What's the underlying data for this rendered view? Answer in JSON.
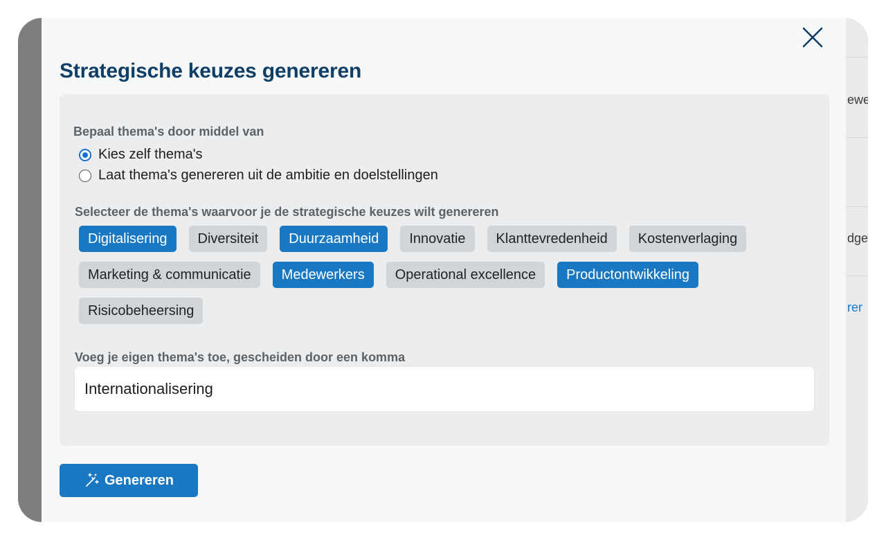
{
  "modal": {
    "title": "Strategische keuzes genereren",
    "close_icon": "close-icon"
  },
  "method": {
    "label": "Bepaal thema's door middel van",
    "options": [
      {
        "label": "Kies zelf thema's",
        "checked": true
      },
      {
        "label": "Laat thema's genereren uit de ambitie en doelstellingen",
        "checked": false
      }
    ]
  },
  "themes": {
    "label": "Selecteer de thema's waarvoor je de strategische keuzes wilt genereren",
    "items": [
      {
        "label": "Digitalisering",
        "selected": true
      },
      {
        "label": "Diversiteit",
        "selected": false
      },
      {
        "label": "Duurzaamheid",
        "selected": true
      },
      {
        "label": "Innovatie",
        "selected": false
      },
      {
        "label": "Klanttevredenheid",
        "selected": false
      },
      {
        "label": "Kostenverlaging",
        "selected": false
      },
      {
        "label": "Marketing & communicatie",
        "selected": false
      },
      {
        "label": "Medewerkers",
        "selected": true
      },
      {
        "label": "Operational excellence",
        "selected": false
      },
      {
        "label": "Productontwikkeling",
        "selected": true
      },
      {
        "label": "Risicobeheersing",
        "selected": false
      }
    ]
  },
  "custom": {
    "label": "Voeg je eigen thema's toe, gescheiden door een komma",
    "value": "Internationalisering"
  },
  "generate": {
    "label": "Genereren",
    "icon": "magic-wand-icon"
  },
  "background": {
    "fragments": [
      "ewe",
      "dge",
      "rer"
    ]
  },
  "colors": {
    "accent": "#1a78c2",
    "title": "#0f3e66",
    "chip_default": "#d2d5d8"
  }
}
